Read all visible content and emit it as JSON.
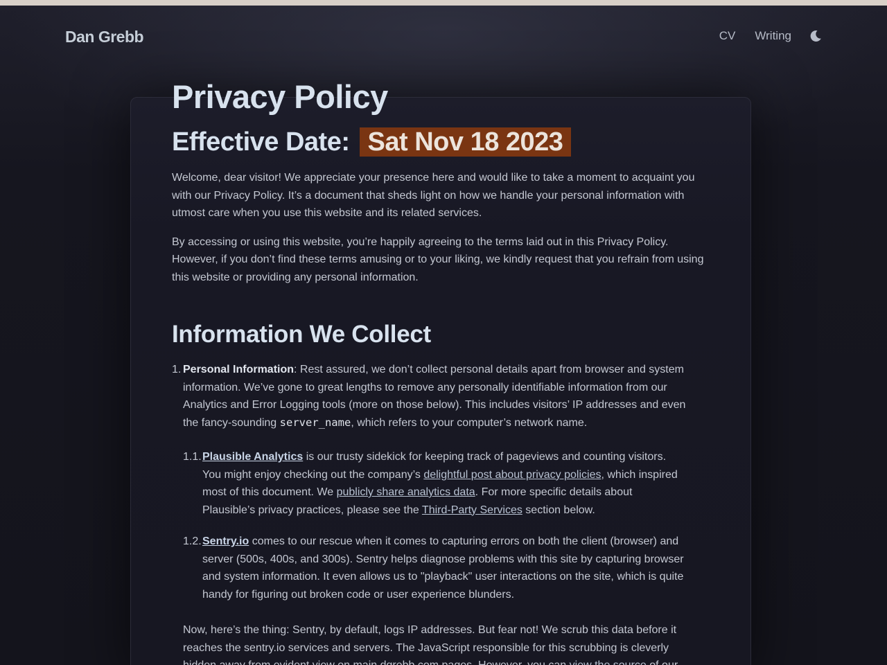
{
  "header": {
    "site_name": "Dan Grebb",
    "nav": [
      {
        "label": "CV"
      },
      {
        "label": "Writing"
      }
    ],
    "theme_toggle_icon": "moon-icon"
  },
  "page": {
    "title": "Privacy Policy",
    "effective_label": "Effective Date:",
    "effective_date": "Sat Nov 18 2023",
    "intro_paragraphs": [
      "Welcome, dear visitor! We appreciate your presence here and would like to take a moment to acquaint you with our Privacy Policy. It’s a document that sheds light on how we handle your personal information with utmost care when you use this website and its related services.",
      "By accessing or using this website, you’re happily agreeing to the terms laid out in this Privacy Policy. However, if you don’t find these terms amusing or to your liking, we kindly request that you refrain from using this website or providing any personal information."
    ],
    "section_title": "Information We Collect",
    "item1": {
      "number": "1.",
      "term": "Personal Information",
      "text_before_code": ": Rest assured, we don’t collect personal details apart from browser and system information. We’ve gone to great lengths to remove any personally identifiable information from our Analytics and Error Logging tools (more on those below). This includes visitors’ IP addresses and even the fancy-sounding ",
      "code": "server_name",
      "text_after_code": ", which refers to your computer’s network name."
    },
    "sub1": {
      "number": "1.1.",
      "link": "Plausible Analytics",
      "text1": " is our trusty sidekick for keeping track of pageviews and counting visitors. You might enjoy checking out the company’s ",
      "link2": "delightful post about privacy policies",
      "text2": ", which inspired most of this document. We ",
      "link3": "publicly share analytics data",
      "text3": ". For more specific details about Plausible’s privacy practices, please see the ",
      "link4": "Third-Party Services",
      "text4": " section below."
    },
    "sub2": {
      "number": "1.2.",
      "link": "Sentry.io",
      "text1": " comes to our rescue when it comes to capturing errors on both the client (browser) and server (500s, 400s, and 300s). Sentry helps diagnose problems with this site by capturing browser and system information. It even allows us to \"playback\" user interactions on the site, which is quite handy for figuring out broken code or user experience blunders."
    },
    "after_text1": "Now, here’s the thing: Sentry, by default, logs IP addresses. But fear not! We scrub this data before it reaches the sentry.io services and servers. The JavaScript responsible for this scrubbing is cleverly hidden away from evident view on main.dgrebb.com pages. However, you can ",
    "after_link": "view the source",
    "after_text2": " of our"
  },
  "colors": {
    "background": "#15151f",
    "date_badge": "#7a3512",
    "heading": "#d8e2ee"
  }
}
